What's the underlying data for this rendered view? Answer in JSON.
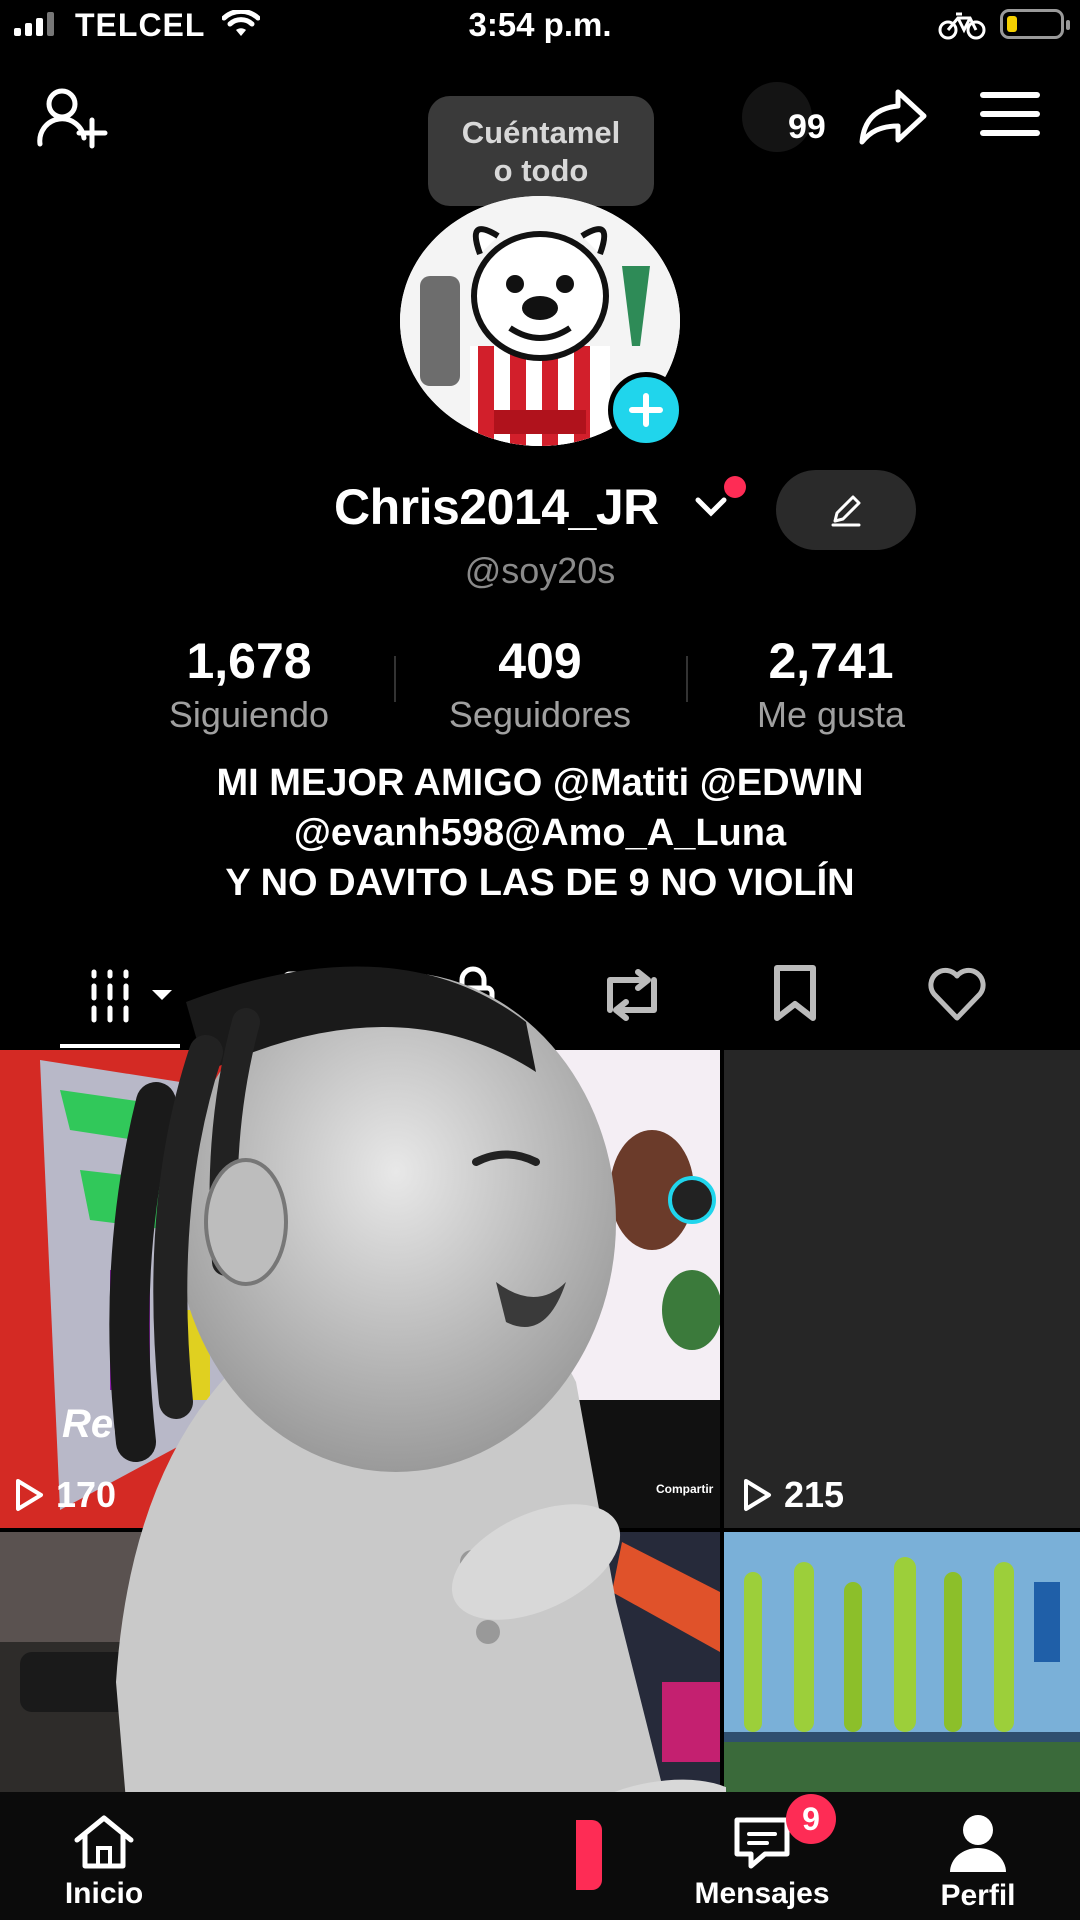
{
  "status_bar": {
    "carrier": "TELCEL",
    "time": "3:54 p.m."
  },
  "header": {
    "tooltip_line1": "Cuéntamel",
    "tooltip_line2": "o todo",
    "story_count": "99"
  },
  "profile": {
    "username": "Chris2014_JR",
    "handle": "@soy20s",
    "stats": [
      {
        "value": "1,678",
        "label": "Siguiendo"
      },
      {
        "value": "409",
        "label": "Seguidores"
      },
      {
        "value": "2,741",
        "label": "Me gusta"
      }
    ],
    "bio_lines": [
      "MI MEJOR AMIGO @Matiti @EDWIN",
      "@evanh598@Amo_A_Luna",
      "Y NO DAVITO LAS DE 9 NO VIOLÍN"
    ]
  },
  "grid": {
    "videos": [
      {
        "views": "170"
      },
      {
        "views": ""
      },
      {
        "views": "215"
      }
    ],
    "tile_texts": {
      "left_caption": "Rec",
      "share_label": "Compartir"
    }
  },
  "bottom_nav": {
    "items": [
      {
        "label": "Inicio",
        "icon": "home-icon"
      },
      {
        "label": "Mensajes",
        "icon": "inbox-icon",
        "badge": "9"
      },
      {
        "label": "Perfil",
        "icon": "profile-icon"
      }
    ]
  },
  "colors": {
    "accent_cyan": "#20d5ec",
    "accent_red": "#fe2c55",
    "background": "#000000"
  }
}
